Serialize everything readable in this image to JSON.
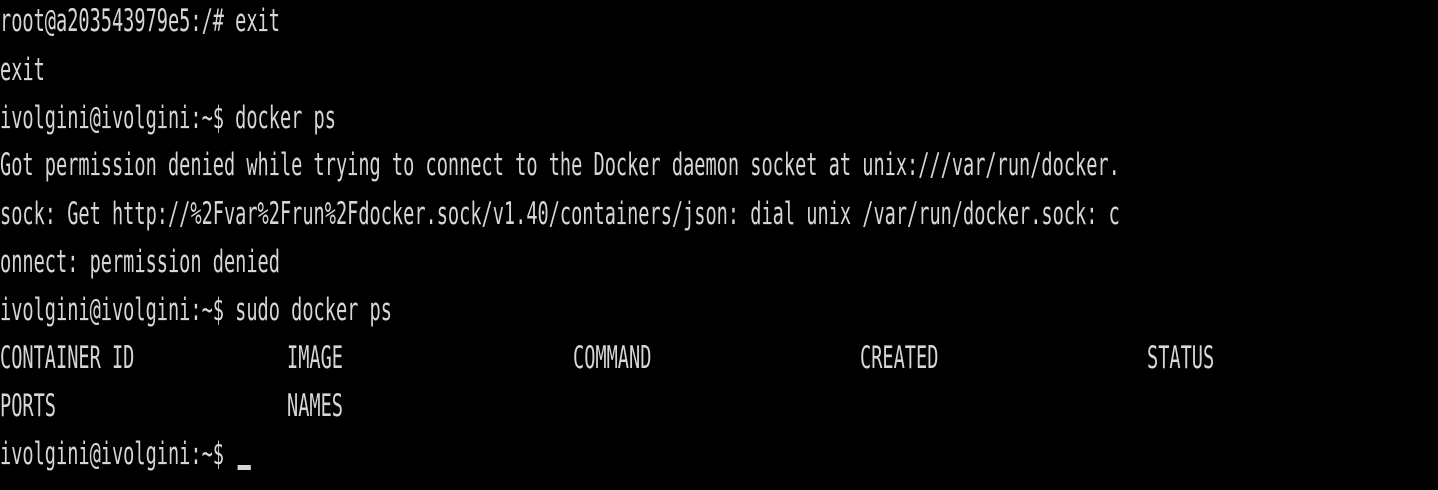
{
  "terminal": {
    "colors": {
      "background": "#000000",
      "foreground": "#d6d6d6"
    },
    "lines": [
      "root@a203543979e5:/# exit",
      "exit",
      "ivolgini@ivolgini:~$ docker ps",
      "Got permission denied while trying to connect to the Docker daemon socket at unix:///var/run/docker.",
      "sock: Get http://%2Fvar%2Frun%2Fdocker.sock/v1.40/containers/json: dial unix /var/run/docker.sock: c",
      "onnect: permission denied",
      "ivolgini@ivolgini:~$ sudo docker ps"
    ],
    "table_header": {
      "container_id": "CONTAINER ID",
      "image": "IMAGE",
      "command": "COMMAND",
      "created": "CREATED",
      "status": "STATUS",
      "ports": "PORTS",
      "names": "NAMES"
    },
    "current_prompt": "ivolgini@ivolgini:~$ "
  }
}
